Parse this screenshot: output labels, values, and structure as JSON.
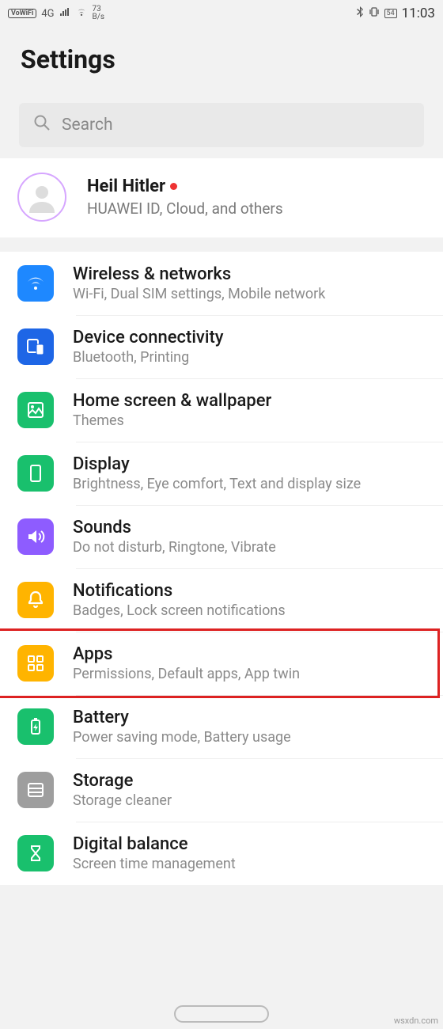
{
  "status": {
    "vowifi": "VoWiFi",
    "net_gen": "4G",
    "speed_num": "73",
    "speed_unit": "B/s",
    "battery": "54",
    "time": "11:03"
  },
  "title": "Settings",
  "search": {
    "placeholder": "Search"
  },
  "account": {
    "name": "Heil Hitler",
    "sub": "HUAWEI ID, Cloud, and others"
  },
  "items": [
    {
      "icon": "wifi-icon",
      "color": "#1e88ff",
      "title": "Wireless & networks",
      "sub": "Wi-Fi, Dual SIM settings, Mobile network"
    },
    {
      "icon": "device-icon",
      "color": "#1e66e6",
      "title": "Device connectivity",
      "sub": "Bluetooth, Printing"
    },
    {
      "icon": "home-screen-icon",
      "color": "#19c06d",
      "title": "Home screen & wallpaper",
      "sub": "Themes"
    },
    {
      "icon": "display-icon",
      "color": "#19c06d",
      "title": "Display",
      "sub": "Brightness, Eye comfort, Text and display size"
    },
    {
      "icon": "sound-icon",
      "color": "#8e5cff",
      "title": "Sounds",
      "sub": "Do not disturb, Ringtone, Vibrate"
    },
    {
      "icon": "bell-icon",
      "color": "#ffb400",
      "title": "Notifications",
      "sub": "Badges, Lock screen notifications"
    },
    {
      "icon": "apps-icon",
      "color": "#ffb400",
      "title": "Apps",
      "sub": "Permissions, Default apps, App twin"
    },
    {
      "icon": "battery-icon",
      "color": "#19c06d",
      "title": "Battery",
      "sub": "Power saving mode, Battery usage"
    },
    {
      "icon": "storage-icon",
      "color": "#9e9e9e",
      "title": "Storage",
      "sub": "Storage cleaner"
    },
    {
      "icon": "hourglass-icon",
      "color": "#19c06d",
      "title": "Digital balance",
      "sub": "Screen time management"
    }
  ],
  "highlight_index": 6,
  "watermark": "wsxdn.com"
}
